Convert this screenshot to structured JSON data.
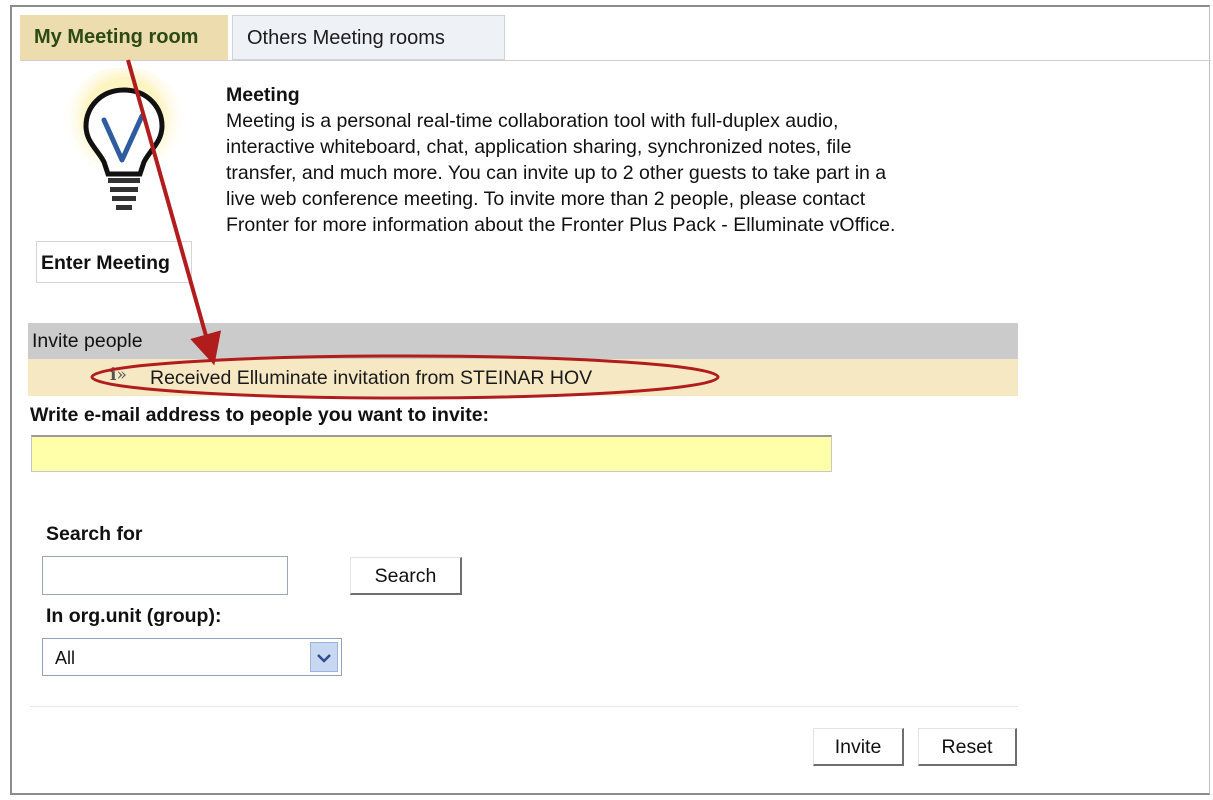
{
  "tabs": [
    {
      "label": "My Meeting room"
    },
    {
      "label": "Others Meeting rooms"
    }
  ],
  "meeting": {
    "title": "Meeting",
    "lines": [
      "Meeting is a personal real-time collaboration tool with full-duplex audio,",
      "interactive whiteboard, chat, application sharing, synchronized notes, file",
      "transfer, and much more. You can invite up to 2 other guests to take part in a",
      "live web conference meeting. To invite more than 2 people, please contact",
      "Fronter for more information about the Fronter Plus Pack - Elluminate vOffice."
    ],
    "enter_label": "Enter Meeting"
  },
  "invite": {
    "header": "Invite people",
    "notice_icon": "ℹ»",
    "notice": "Received Elluminate invitation from STEINAR HOV",
    "email_label": "Write e-mail address to people you want to invite:",
    "email_value": ""
  },
  "search": {
    "label": "Search for",
    "value": "",
    "button": "Search",
    "group_label": "In org.unit (group):",
    "group_selected": "All"
  },
  "actions": {
    "invite": "Invite",
    "reset": "Reset"
  },
  "colors": {
    "active_tab": "#ecdcae",
    "invite_header": "#cbcbcb",
    "notice_bar": "#f6e8c3",
    "email_field": "#ffffaa",
    "annotation": "#b11d1d"
  },
  "icons": {
    "bulb": "lightbulb-icon",
    "notice": "info-icon",
    "dropdown": "chevron-down-icon"
  }
}
